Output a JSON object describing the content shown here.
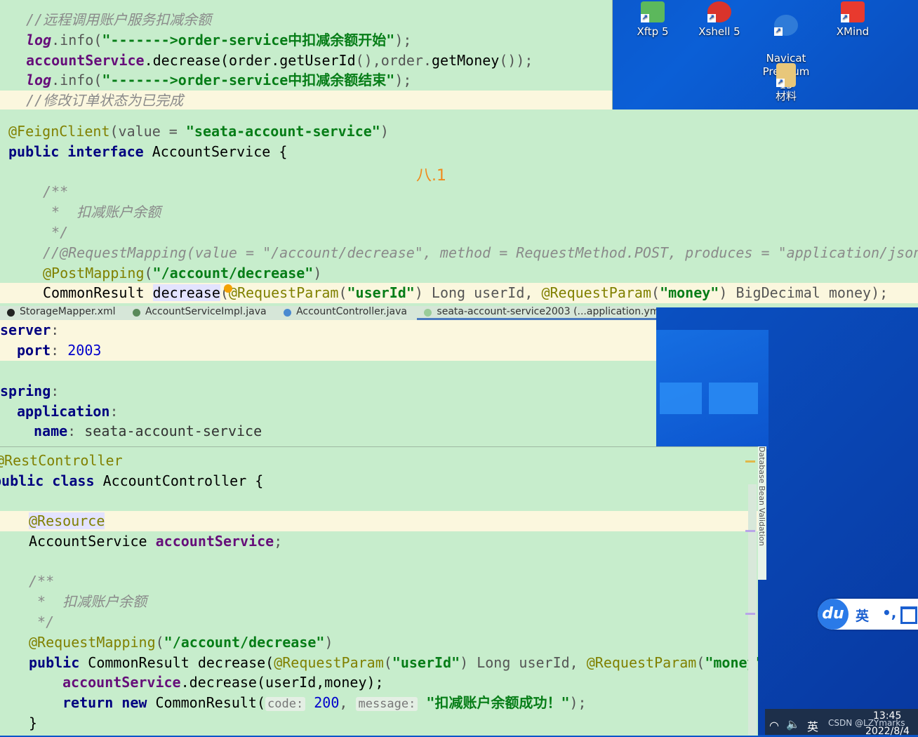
{
  "desktop": {
    "icons": [
      {
        "label": "Xftp 5",
        "icon": "xftp-icon",
        "color": "#5cb85c"
      },
      {
        "label": "Xshell 5",
        "icon": "xshell-icon",
        "color": "#d9342b"
      },
      {
        "label": "Navicat\nPremium 15",
        "icon": "navicat-icon",
        "color": "#2f7bd8"
      },
      {
        "label": "XMind",
        "icon": "xmind-icon",
        "color": "#e83a2e"
      },
      {
        "label": "材料",
        "icon": "folder-icon",
        "color": "#e8c77a"
      }
    ],
    "annotation": "八.1"
  },
  "panel_order_service": {
    "lines": [
      "//远程调用账户服务扣减余额",
      [
        "log",
        ".info(",
        "\"------->order-service中扣减余额开始\"",
        ");"
      ],
      [
        "accountService",
        ".decrease(order.",
        "getUserId",
        "(),order.",
        "getMoney",
        "());"
      ],
      [
        "log",
        ".info(",
        "\"------->order-service中扣减余额结束\"",
        ");"
      ],
      "//修改订单状态为已完成"
    ]
  },
  "panel_feign": {
    "l1": [
      "@FeignClient",
      "(value = ",
      "\"seata-account-service\"",
      ")"
    ],
    "l2": [
      "public",
      "interface",
      "AccountService {"
    ],
    "doc": [
      "/**",
      " *  扣减账户余额",
      " */"
    ],
    "commented": "//@RequestMapping(value = \"/account/decrease\", method = RequestMethod.POST, produces = \"application/json",
    "post": [
      "@PostMapping",
      "(",
      "\"/account/decrease\"",
      ")"
    ],
    "sig": [
      "CommonResult ",
      "decrease",
      "(",
      "@RequestParam",
      "(",
      "\"userId\"",
      ") Long userId, ",
      "@RequestParam",
      "(",
      "\"money\"",
      ") BigDecimal money);"
    ]
  },
  "tabs": [
    "StorageMapper.xml",
    "AccountServiceImpl.java",
    "AccountController.java",
    "seata-account-service2003 (...application.yml)"
  ],
  "panel_yaml": {
    "server_key": "server",
    "port_key": "port",
    "port_val": "2003",
    "spring_key": "spring",
    "app_key": "application",
    "name_key": "name",
    "name_val": "seata-account-service"
  },
  "panel_controller": {
    "rest": "@RestController",
    "cls": [
      "public",
      "class",
      "AccountController {"
    ],
    "resource": "@Resource",
    "field": [
      "AccountService ",
      "accountService",
      ";"
    ],
    "doc": [
      "/**",
      " *  扣减账户余额",
      " */"
    ],
    "mapping": [
      "@RequestMapping",
      "(",
      "\"/account/decrease\"",
      ")"
    ],
    "sig": [
      "public",
      "CommonResult decrease(",
      "@RequestParam",
      "(",
      "\"userId\"",
      ") Long userId, ",
      "@RequestParam",
      "(",
      "\"money\""
    ],
    "call": [
      "accountService",
      ".decrease(userId,money);"
    ],
    "ret": [
      "return",
      "new",
      "CommonResult(",
      "code:",
      "200",
      ", ",
      "message:",
      "\"扣减账户余额成功！\"",
      ");"
    ],
    "close": "}"
  },
  "sidebar_strip": {
    "labels": [
      "Database",
      "Bean Validation"
    ]
  },
  "ime": {
    "brand": "du",
    "lang": "英",
    "punct": "•,"
  },
  "taskbar": {
    "lang": "英",
    "time": "13:45",
    "date": "2022/8/4",
    "watermark": "CSDN @LZYmarks"
  }
}
